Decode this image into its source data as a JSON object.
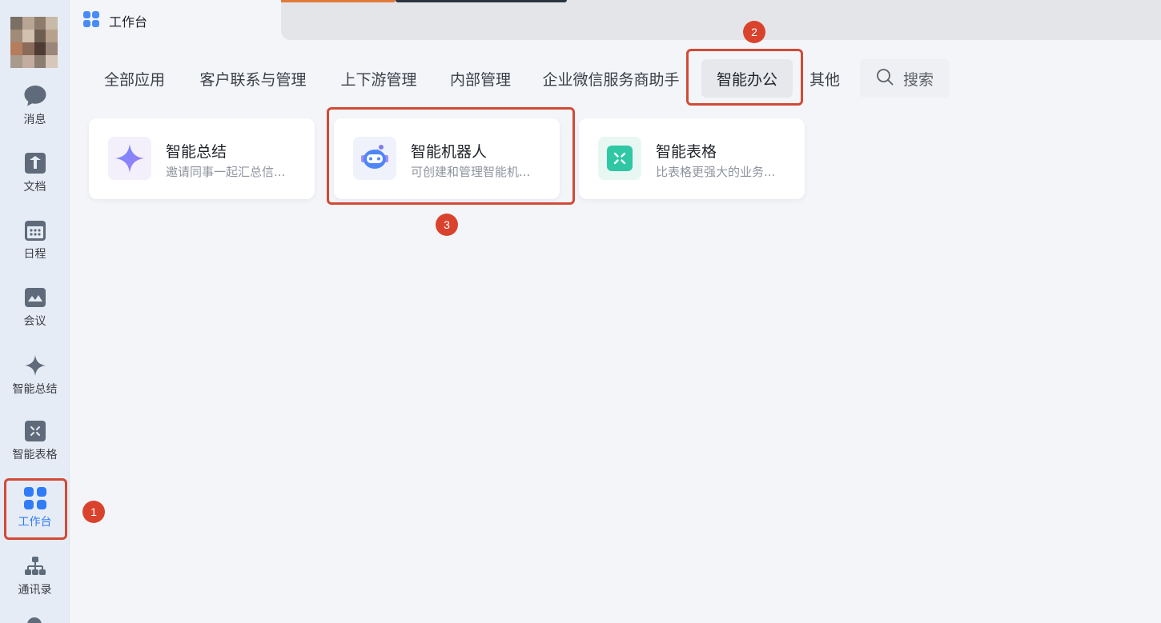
{
  "window": {
    "tab_title": "工作台"
  },
  "sidebar": {
    "items": [
      {
        "label": "消息",
        "icon": "chat-bubble-icon"
      },
      {
        "label": "文档",
        "icon": "document-icon"
      },
      {
        "label": "日程",
        "icon": "calendar-icon"
      },
      {
        "label": "会议",
        "icon": "meeting-icon"
      },
      {
        "label": "智能总结",
        "icon": "sparkle-icon"
      },
      {
        "label": "智能表格",
        "icon": "smart-sheet-icon"
      },
      {
        "label": "工作台",
        "icon": "workbench-grid-icon",
        "active": true
      },
      {
        "label": "通讯录",
        "icon": "org-chart-icon"
      }
    ]
  },
  "categories": {
    "tabs": [
      {
        "label": "全部应用"
      },
      {
        "label": "客户联系与管理"
      },
      {
        "label": "上下游管理"
      },
      {
        "label": "内部管理"
      },
      {
        "label": "企业微信服务商助手"
      },
      {
        "label": "智能办公",
        "active": true
      },
      {
        "label": "其他"
      }
    ],
    "search_label": "搜索"
  },
  "apps": [
    {
      "title": "智能总结",
      "desc": "邀请同事一起汇总信...",
      "icon": "sparkle-icon"
    },
    {
      "title": "智能机器人",
      "desc": "可创建和管理智能机...",
      "icon": "robot-icon"
    },
    {
      "title": "智能表格",
      "desc": "比表格更强大的业务...",
      "icon": "smart-sheet-icon"
    }
  ],
  "annotations": {
    "markers": [
      "1",
      "2",
      "3"
    ]
  },
  "colors": {
    "accent": "#2f7cf6",
    "highlight": "#d24a35",
    "sheet_green": "#2fc7a4"
  }
}
